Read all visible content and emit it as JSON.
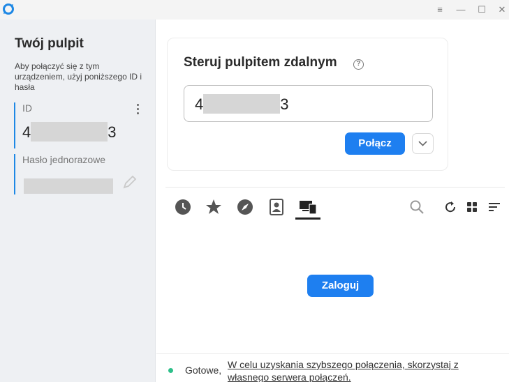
{
  "window": {
    "menu_glyph": "≡",
    "minimize_glyph": "—",
    "maximize_glyph": "☐",
    "close_glyph": "✕"
  },
  "sidebar": {
    "title": "Twój pulpit",
    "description": "Aby połączyć się z tym urządzeniem, użyj poniższego ID i hasła",
    "id_label": "ID",
    "id_value_start": "4",
    "id_value_end": "3",
    "password_label": "Hasło jednorazowe"
  },
  "remote": {
    "title": "Steruj pulpitem zdalnym",
    "id_input_start": "4",
    "id_input_end": "3",
    "connect_label": "Połącz"
  },
  "tabs": [
    {
      "icon": "history-icon"
    },
    {
      "icon": "favorites-star-icon"
    },
    {
      "icon": "discovered-compass-icon"
    },
    {
      "icon": "address-book-icon"
    },
    {
      "icon": "accessible-devices-icon",
      "active": true
    }
  ],
  "toolbar_right": [
    "search-icon",
    "refresh-icon",
    "grid-view-icon",
    "sort-icon"
  ],
  "main": {
    "login_label": "Zaloguj"
  },
  "status": {
    "state": "Gotowe,",
    "hint": "W celu uzyskania szybszego połączenia, skorzystaj z własnego serwera połączeń."
  },
  "colors": {
    "accent": "#1e7ff0",
    "status_ok": "#2ebf8a",
    "sidebar_bg": "#eef0f3"
  }
}
